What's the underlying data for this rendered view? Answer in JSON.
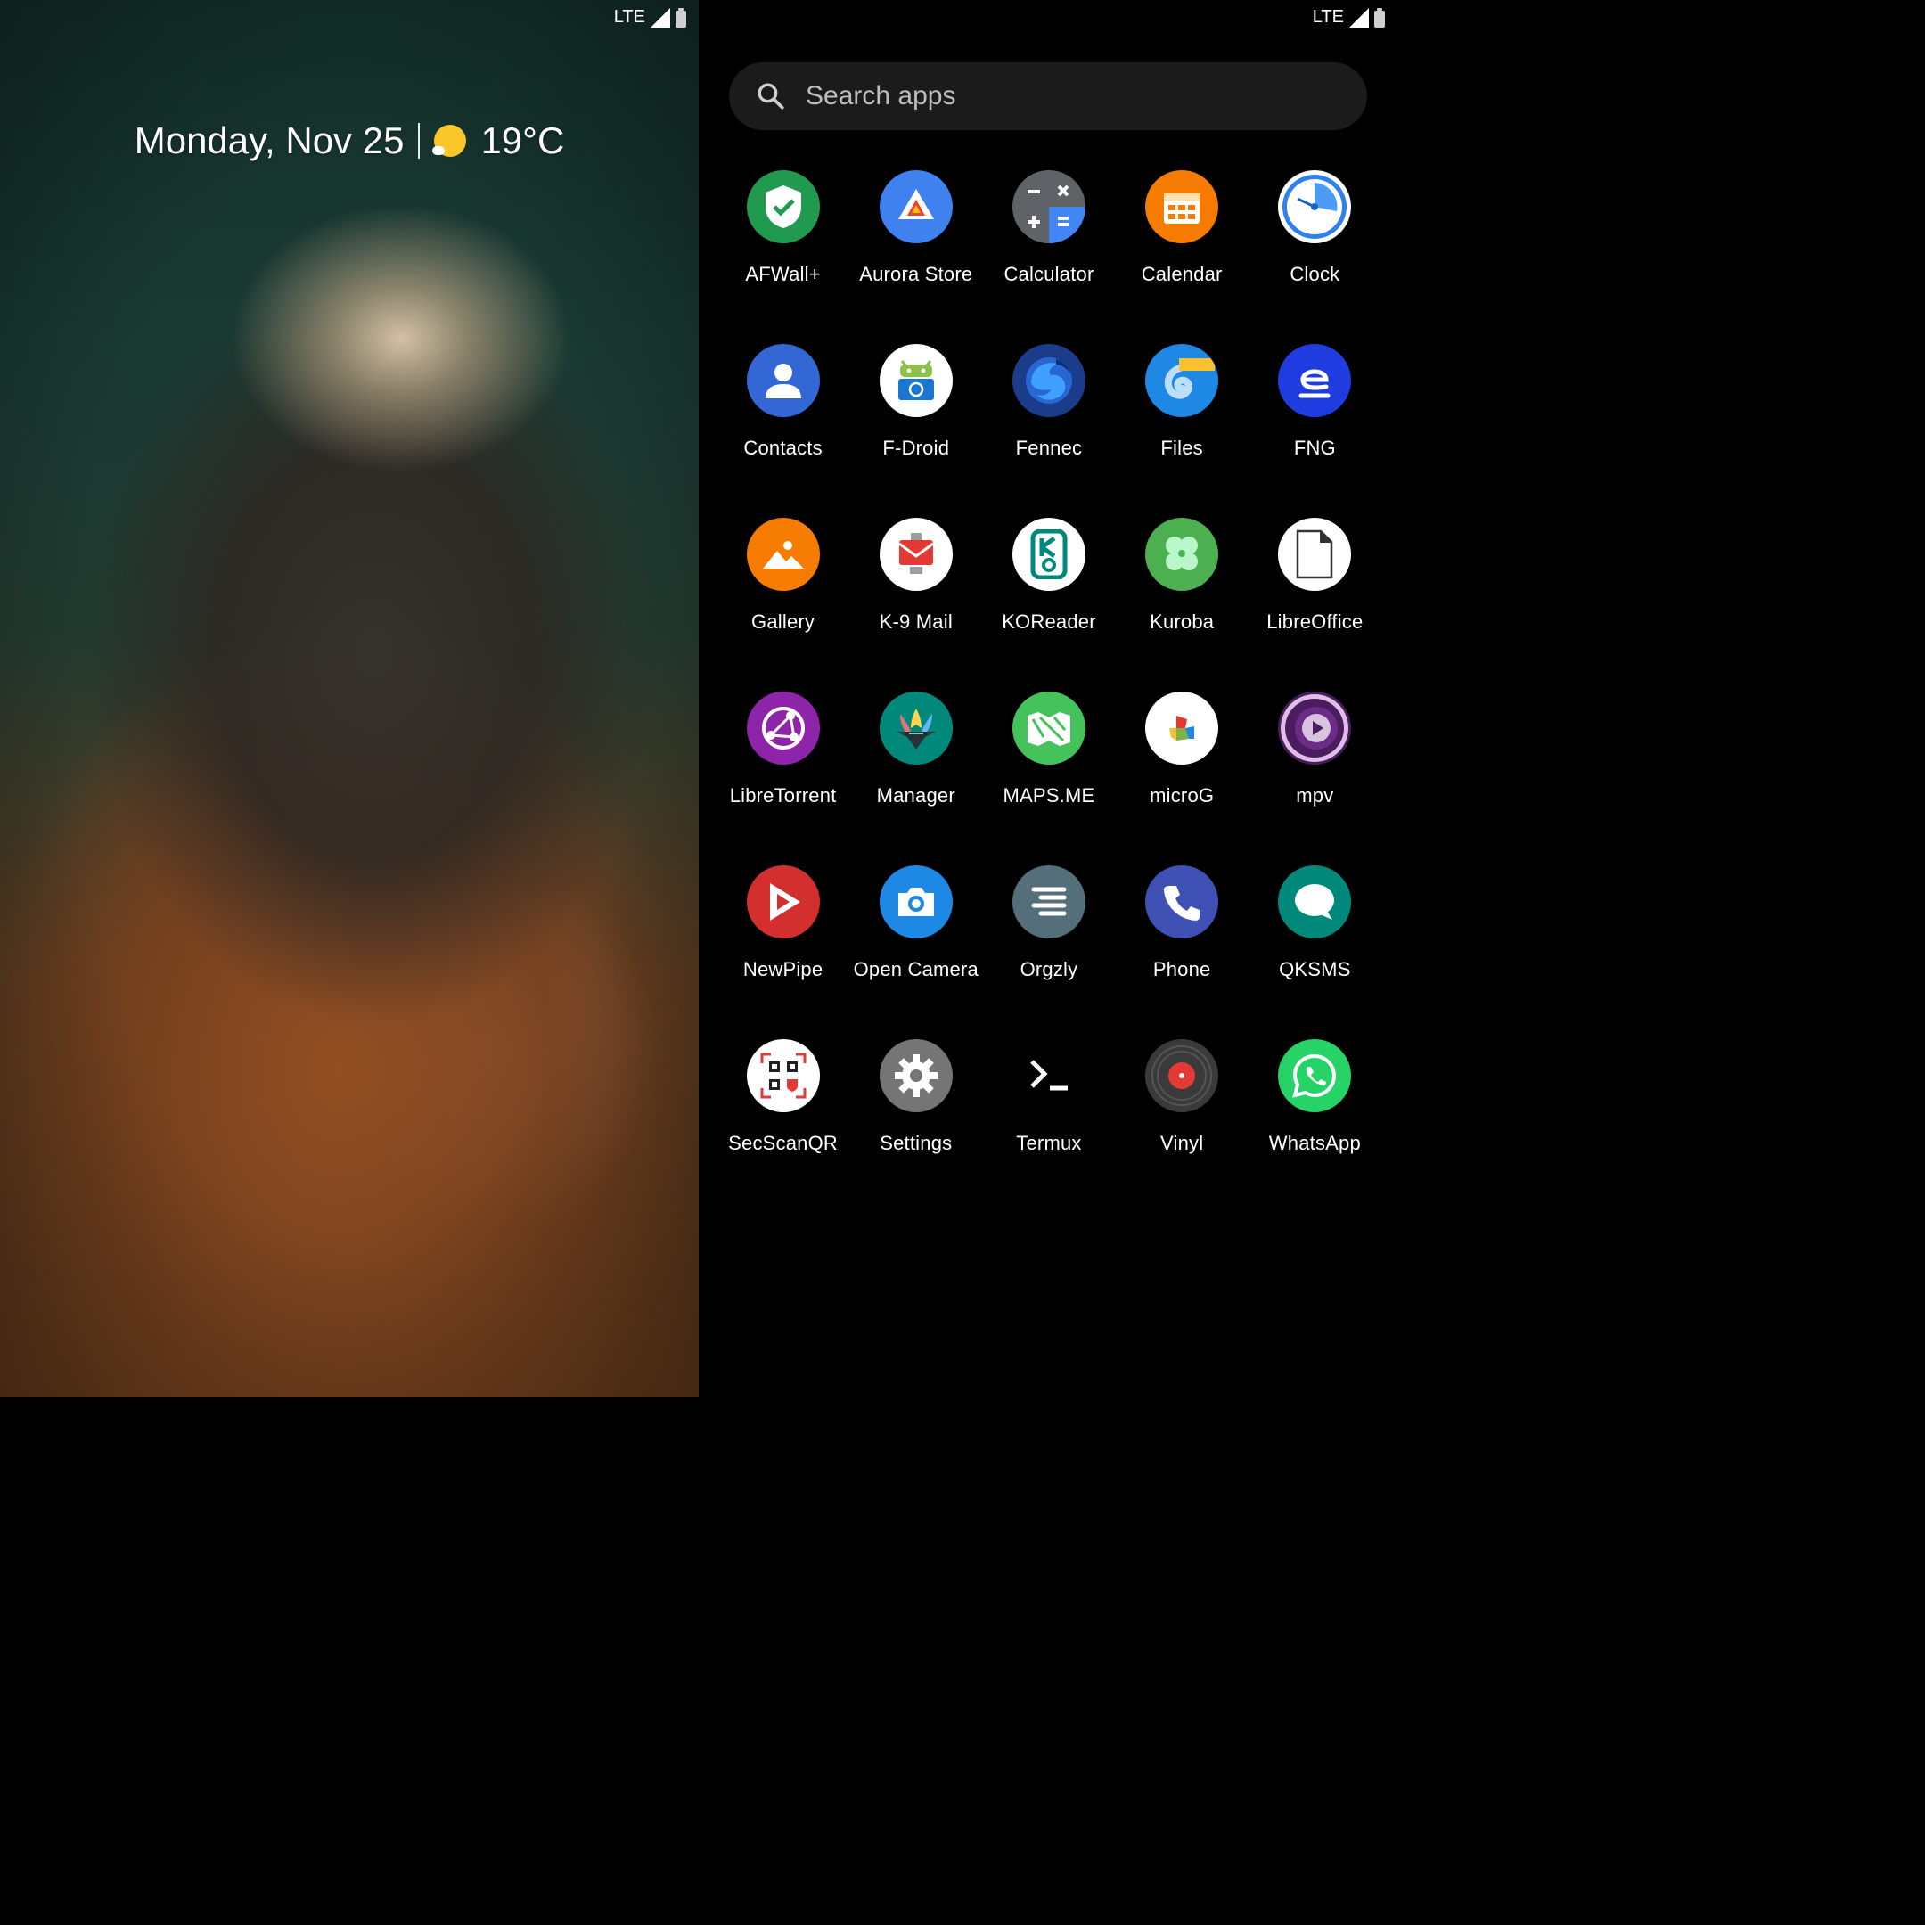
{
  "home": {
    "status": {
      "network": "LTE"
    },
    "glance": {
      "date": "Monday, Nov 25",
      "temperature": "19°C"
    }
  },
  "drawer": {
    "status": {
      "network": "LTE"
    },
    "search": {
      "placeholder": "Search apps"
    },
    "apps": [
      {
        "label": "AFWall+",
        "color": "#1f9a4f",
        "icon": "shield-check-icon"
      },
      {
        "label": "Aurora Store",
        "color": "#3f82ef",
        "icon": "store-bag-icon"
      },
      {
        "label": "Calculator",
        "color": "#5f6368",
        "icon": "calculator-icon"
      },
      {
        "label": "Calendar",
        "color": "#f57c00",
        "icon": "calendar-icon"
      },
      {
        "label": "Clock",
        "color": "#ffffff",
        "icon": "clock-icon"
      },
      {
        "label": "Contacts",
        "color": "#3367d6",
        "icon": "person-icon"
      },
      {
        "label": "F-Droid",
        "color": "#ffffff",
        "icon": "android-icon"
      },
      {
        "label": "Fennec",
        "color": "#1a3c8a",
        "icon": "fox-globe-icon"
      },
      {
        "label": "Files",
        "color": "#1e88e5",
        "icon": "folder-swirl-icon"
      },
      {
        "label": "FNG",
        "color": "#1e3ce0",
        "icon": "fng-icon"
      },
      {
        "label": "Gallery",
        "color": "#f57c00",
        "icon": "mountain-image-icon"
      },
      {
        "label": "K-9 Mail",
        "color": "#ffffff",
        "icon": "envelope-robot-icon"
      },
      {
        "label": "KOReader",
        "color": "#ffffff",
        "icon": "koreader-icon"
      },
      {
        "label": "Kuroba",
        "color": "#4caf50",
        "icon": "clover-icon"
      },
      {
        "label": "LibreOffice",
        "color": "#ffffff",
        "icon": "document-icon"
      },
      {
        "label": "LibreTorrent",
        "color": "#8e24aa",
        "icon": "torrent-icon"
      },
      {
        "label": "Manager",
        "color": "#00897b",
        "icon": "magisk-mask-icon"
      },
      {
        "label": "MAPS.ME",
        "color": "#43c35a",
        "icon": "map-icon"
      },
      {
        "label": "microG",
        "color": "#ffffff",
        "icon": "puzzle-icon"
      },
      {
        "label": "mpv",
        "color": "#4a1d5e",
        "icon": "play-circle-icon"
      },
      {
        "label": "NewPipe",
        "color": "#d32f2f",
        "icon": "play-triangle-icon"
      },
      {
        "label": "Open Camera",
        "color": "#1e88e5",
        "icon": "camera-icon"
      },
      {
        "label": "Orgzly",
        "color": "#546e7a",
        "icon": "lines-icon"
      },
      {
        "label": "Phone",
        "color": "#3f51b5",
        "icon": "phone-handset-icon"
      },
      {
        "label": "QKSMS",
        "color": "#00897b",
        "icon": "chat-bubble-icon"
      },
      {
        "label": "SecScanQR",
        "color": "#ffffff",
        "icon": "qr-code-icon"
      },
      {
        "label": "Settings",
        "color": "#757575",
        "icon": "gear-icon"
      },
      {
        "label": "Termux",
        "color": "#000000",
        "icon": "terminal-prompt-icon"
      },
      {
        "label": "Vinyl",
        "color": "#3a3a3a",
        "icon": "vinyl-record-icon"
      },
      {
        "label": "WhatsApp",
        "color": "#25d366",
        "icon": "whatsapp-icon"
      }
    ]
  }
}
